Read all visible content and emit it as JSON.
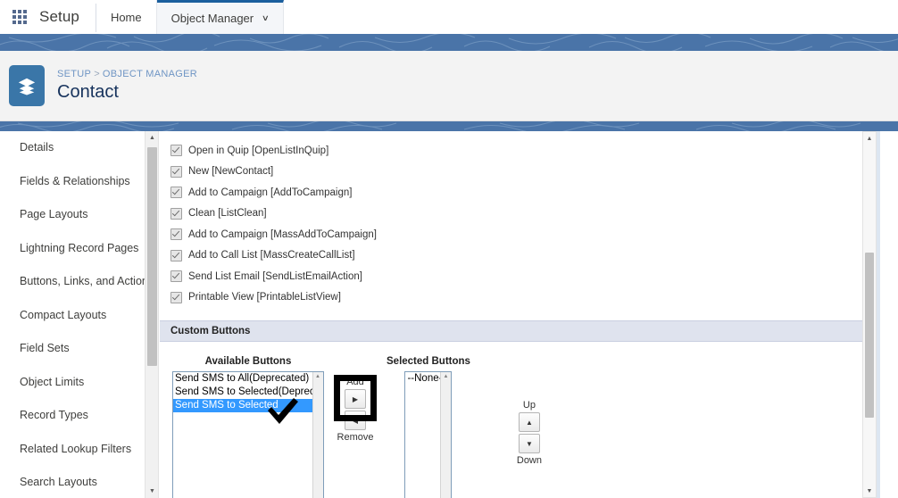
{
  "globalnav": {
    "app_launcher_name": "app-launcher-icon",
    "setup_label": "Setup",
    "tabs": [
      {
        "label": "Home",
        "active": false,
        "has_caret": false
      },
      {
        "label": "Object Manager",
        "active": true,
        "has_caret": true
      }
    ],
    "caret_glyph": "∨"
  },
  "pageheader": {
    "icon_name": "layers-icon",
    "breadcrumb": {
      "setup": "SETUP",
      "separator": ">",
      "object_manager": "OBJECT MANAGER"
    },
    "title": "Contact"
  },
  "sidebar": {
    "items": [
      {
        "label": "Details"
      },
      {
        "label": "Fields & Relationships"
      },
      {
        "label": "Page Layouts"
      },
      {
        "label": "Lightning Record Pages"
      },
      {
        "label": "Buttons, Links, and Actions"
      },
      {
        "label": "Compact Layouts"
      },
      {
        "label": "Field Sets"
      },
      {
        "label": "Object Limits"
      },
      {
        "label": "Record Types"
      },
      {
        "label": "Related Lookup Filters"
      },
      {
        "label": "Search Layouts"
      }
    ],
    "scrollbar": {
      "up_glyph": "▲",
      "down_glyph": "▼"
    }
  },
  "main": {
    "standard_buttons": [
      {
        "label": "Open in Quip [OpenListInQuip]",
        "checked": true,
        "disabled": true
      },
      {
        "label": "New [NewContact]",
        "checked": true,
        "disabled": true
      },
      {
        "label": "Add to Campaign [AddToCampaign]",
        "checked": true,
        "disabled": true
      },
      {
        "label": "Clean [ListClean]",
        "checked": true,
        "disabled": true
      },
      {
        "label": "Add to Campaign [MassAddToCampaign]",
        "checked": true,
        "disabled": true
      },
      {
        "label": "Add to Call List [MassCreateCallList]",
        "checked": true,
        "disabled": true
      },
      {
        "label": "Send List Email [SendListEmailAction]",
        "checked": true,
        "disabled": true
      },
      {
        "label": "Printable View [PrintableListView]",
        "checked": true,
        "disabled": true
      }
    ],
    "section_title": "Custom Buttons",
    "available": {
      "label": "Available Buttons",
      "options": [
        {
          "text": "Send SMS to All(Deprecated)",
          "selected": false
        },
        {
          "text": "Send SMS to Selected(Deprecated))",
          "selected": false
        },
        {
          "text": "Send SMS to Selected",
          "selected": true
        }
      ]
    },
    "selected": {
      "label": "Selected Buttons",
      "options": [
        {
          "text": "--None--",
          "selected": false
        }
      ]
    },
    "mover": {
      "add_label": "Add",
      "add_glyph": "▶",
      "remove_label": "Remove",
      "remove_glyph": "◀",
      "highlighted": "add"
    },
    "reorder": {
      "up_label": "Up",
      "up_glyph": "▲",
      "down_label": "Down",
      "down_glyph": "▼"
    },
    "scrollbar": {
      "up_glyph": "▲",
      "down_glyph": "▼"
    }
  },
  "colors": {
    "brand_blue": "#1b5f9e",
    "band_blue": "#4a74a8",
    "icon_blue": "#3a76a8",
    "breadcrumb_blue": "#6f95c4",
    "title_navy": "#16325c",
    "select_blue": "#3399ff",
    "section_bg": "#dfe3ee",
    "annotation_black": "#000000"
  }
}
